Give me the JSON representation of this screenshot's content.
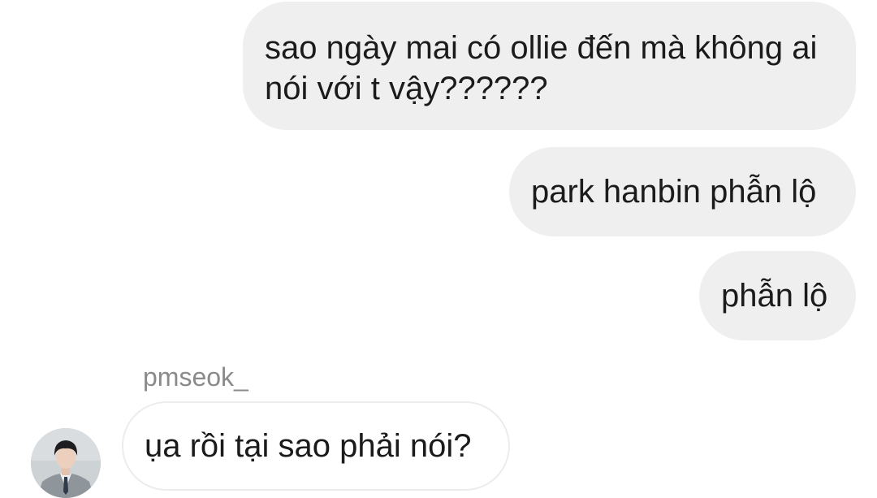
{
  "conversation": {
    "outgoing": [
      {
        "text": "sao ngày mai có ollie đến mà không ai nói với t vậy??????"
      },
      {
        "text": "park hanbin phẫn lộ"
      },
      {
        "text": "phẫn lộ"
      }
    ],
    "incoming": {
      "sender": "pmseok_",
      "text": "ụa rồi tại sao phải nói?",
      "avatar_icon": "profile-photo-icon"
    }
  },
  "colors": {
    "outgoing_bubble_bg": "#efefef",
    "incoming_bubble_border": "#ececec",
    "sender_text": "#8a8a8a",
    "page_bg": "#ffffff"
  }
}
